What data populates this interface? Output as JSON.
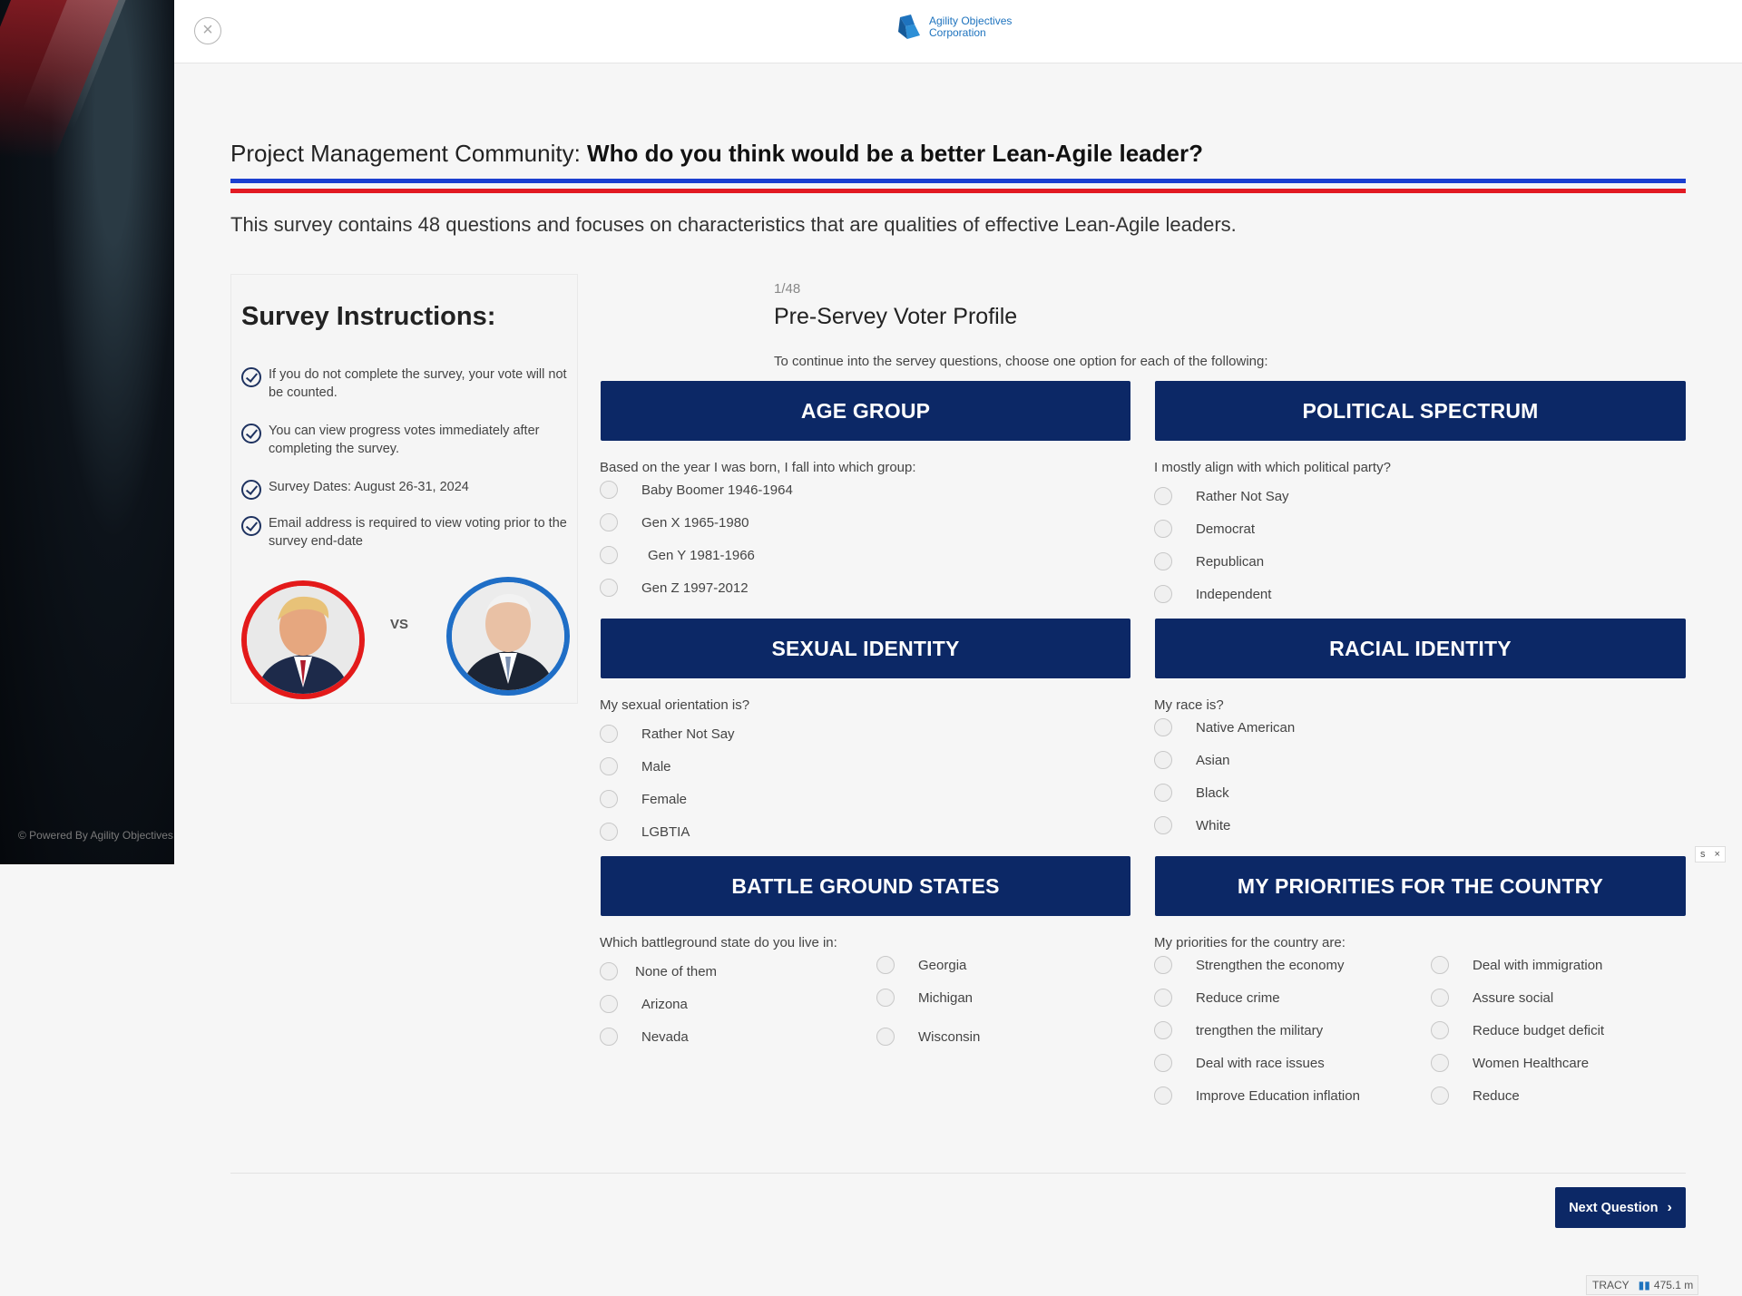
{
  "side_panel": {
    "powered_by": "© Powered By Agility Objectives"
  },
  "header": {
    "logo_text_line1": "Agility Objectives",
    "logo_text_line2": "Corporation"
  },
  "page": {
    "title_prefix": "Project Management Community: ",
    "title_bold": "Who do you think would be a better Lean-Agile leader?",
    "intro": "This survey contains 48 questions and focuses on characteristics that are qualities of effective Lean-Agile leaders."
  },
  "instructions": {
    "heading": "Survey Instructions:",
    "items": [
      "If you do not complete the survey, your vote will not be counted.",
      "You can view progress votes immediately after completing the survey.",
      "Survey Dates: August 26-31, 2024",
      "Email address is required to view voting prior to the survey end-date"
    ],
    "vs": "VS"
  },
  "question": {
    "number": "1/48",
    "title": "Pre-Servey Voter Profile",
    "description": "To continue into the servey questions, choose one option for each of the following:"
  },
  "groups": {
    "age": {
      "title": "AGE GROUP",
      "label": "Based on the year I was born, I fall into which group:",
      "options": [
        "Baby Boomer 1946-1964",
        "Gen X 1965-1980",
        "Gen Y 1981-1966",
        "Gen Z 1997-2012"
      ]
    },
    "political": {
      "title": "POLITICAL SPECTRUM",
      "label": "I mostly align with which political party?",
      "options": [
        "Rather Not Say",
        "Democrat",
        "Republican",
        "Independent"
      ]
    },
    "sexual": {
      "title": "SEXUAL IDENTITY",
      "label": "My sexual orientation is?",
      "options": [
        "Rather Not Say",
        "Male",
        "Female",
        "LGBTIA"
      ]
    },
    "racial": {
      "title": "RACIAL IDENTITY",
      "label": "My race is?",
      "options": [
        "Native American",
        "Asian",
        "Black",
        "White"
      ]
    },
    "battleground": {
      "title": "BATTLE GROUND STATES",
      "label": "Which battleground state do you live in:",
      "options": [
        "None of them",
        "Arizona",
        "Nevada",
        "Georgia",
        "Michigan",
        "Wisconsin"
      ]
    },
    "priorities": {
      "title": "MY PRIORITIES FOR THE COUNTRY",
      "label": "My priorities for the country are:",
      "options": [
        "Strengthen the economy",
        "Reduce crime",
        "trengthen the military",
        "Deal with race issues",
        "Improve Education inflation",
        "Deal with immigration",
        "Assure social",
        "Reduce budget deficit",
        "Women Healthcare",
        "Reduce"
      ]
    }
  },
  "footer": {
    "next_label": "Next Question",
    "chevron": "›"
  },
  "overlay": {
    "ad_close_left": "s",
    "ad_close_x": "×",
    "tracy_label": "TRACY",
    "tracy_value": "475.1 m"
  },
  "colors": {
    "navy": "#0c2866",
    "rule_blue": "#1b3fd0",
    "rule_red": "#e21b23",
    "logo_blue": "#1e73be"
  }
}
